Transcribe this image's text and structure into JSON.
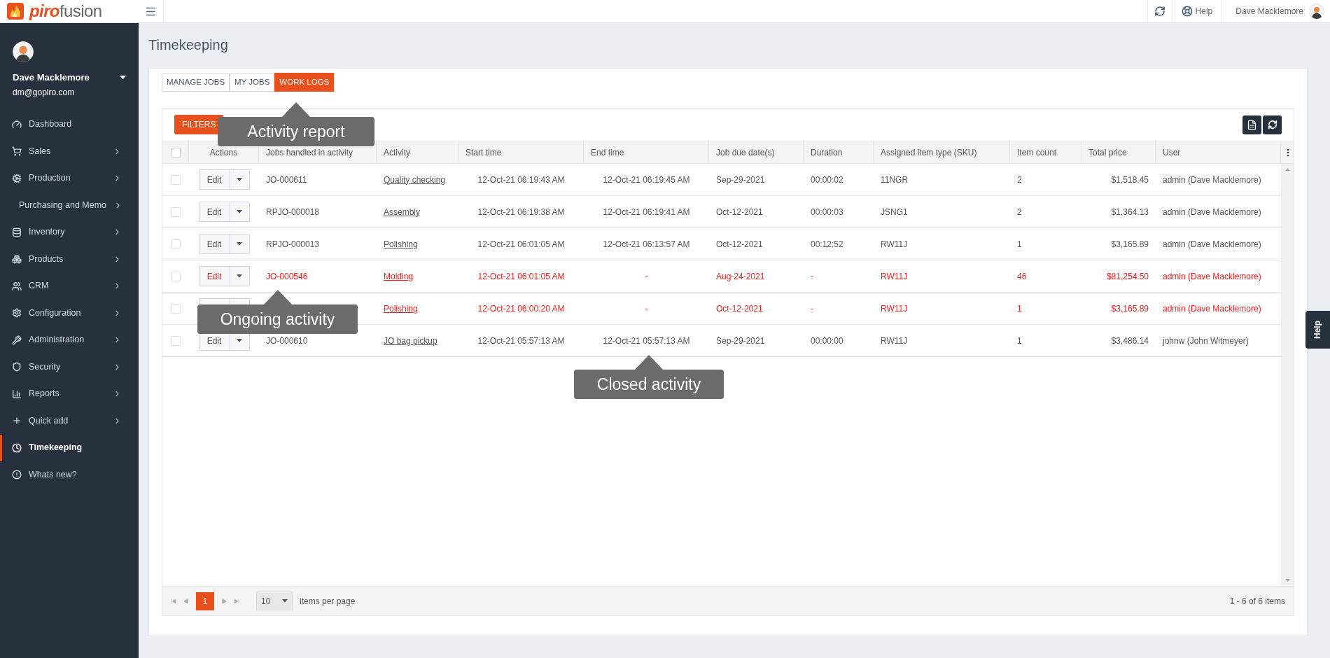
{
  "header": {
    "logo": "**piro**fusion",
    "help": "Help",
    "user": "Dave Macklemore"
  },
  "sidebar": {
    "user_name": "Dave Macklemore",
    "user_email": "dm@gopiro.com",
    "items": [
      {
        "label": "Dashboard",
        "selected": false,
        "chevron": false
      },
      {
        "label": "Sales",
        "selected": false,
        "chevron": true
      },
      {
        "label": "Production",
        "selected": false,
        "chevron": true
      },
      {
        "label": "Purchasing and Memo",
        "selected": false,
        "chevron": true
      },
      {
        "label": "Inventory",
        "selected": false,
        "chevron": true
      },
      {
        "label": "Products",
        "selected": false,
        "chevron": true
      },
      {
        "label": "CRM",
        "selected": false,
        "chevron": true
      },
      {
        "label": "Configuration",
        "selected": false,
        "chevron": true
      },
      {
        "label": "Administration",
        "selected": false,
        "chevron": true
      },
      {
        "label": "Security",
        "selected": false,
        "chevron": true
      },
      {
        "label": "Reports",
        "selected": false,
        "chevron": true
      },
      {
        "label": "Quick add",
        "selected": false,
        "chevron": true
      },
      {
        "label": "Timekeeping",
        "selected": true,
        "chevron": false
      },
      {
        "label": "Whats new?",
        "selected": false,
        "chevron": false
      }
    ]
  },
  "page_title": "Timekeeping",
  "tabs": [
    {
      "label": "MANAGE JOBS",
      "selected": false
    },
    {
      "label": "MY JOBS",
      "selected": false
    },
    {
      "label": "WORK LOGS",
      "selected": true
    }
  ],
  "filters_button": "FILTERS",
  "table": {
    "select_all": {
      "checked": false
    },
    "columns": [
      "Actions",
      "Jobs handled in activity",
      "Activity",
      "Start time",
      "End time",
      "Job due date(s)",
      "Duration",
      "Assigned item type (SKU)",
      "Item count",
      "Total price",
      "User"
    ],
    "rows": [
      {
        "ongoing": false,
        "edit": "Edit",
        "job": "JO-000611",
        "activity": "Quality checking",
        "start": "12-Oct-21 06:19:43 AM",
        "end": "12-Oct-21 06:19:45 AM",
        "due": "Sep-29-2021",
        "duration": "00:00:02",
        "sku": "11NGR",
        "count": "2",
        "price": "$1,518.45",
        "user": "admin (Dave Macklemore)"
      },
      {
        "ongoing": false,
        "edit": "Edit",
        "job": "RPJO-000018",
        "activity": "Assembly",
        "start": "12-Oct-21 06:19:38 AM",
        "end": "12-Oct-21 06:19:41 AM",
        "due": "Oct-12-2021",
        "duration": "00:00:03",
        "sku": "JSNG1",
        "count": "2",
        "price": "$1,364.13",
        "user": "admin (Dave Macklemore)"
      },
      {
        "ongoing": false,
        "edit": "Edit",
        "job": "RPJO-000013",
        "activity": "Polishing",
        "start": "12-Oct-21 06:01:05 AM",
        "end": "12-Oct-21 06:13:57 AM",
        "due": "Oct-12-2021",
        "duration": "00:12:52",
        "sku": "RW11J",
        "count": "1",
        "price": "$3,165.89",
        "user": "admin (Dave Macklemore)"
      },
      {
        "ongoing": true,
        "edit": "Edit",
        "job": "JO-000546",
        "activity": "Molding",
        "start": "12-Oct-21 06:01:05 AM",
        "end": "-",
        "due": "Aug-24-2021",
        "duration": "-",
        "sku": "RW11J",
        "count": "46",
        "price": "$81,254.50",
        "user": "admin (Dave Macklemore)"
      },
      {
        "ongoing": true,
        "activity": "Polishing",
        "start": "12-Oct-21 06:00:20 AM",
        "end": "-",
        "due": "Oct-12-2021",
        "duration": "-",
        "sku": "RW11J",
        "count": "1",
        "price": "$3,165.89",
        "user": "admin (Dave Macklemore)"
      },
      {
        "ongoing": false,
        "edit": "Edit",
        "job": "JO-000610",
        "activity": "JO bag pickup",
        "start": "12-Oct-21 05:57:13 AM",
        "end": "12-Oct-21 05:57:13 AM",
        "due": "Sep-29-2021",
        "duration": "00:00:00",
        "sku": "RW11J",
        "count": "1",
        "price": "$3,486.14",
        "user": "johnw (John Witmeyer)"
      }
    ]
  },
  "pager": {
    "pages": [
      {
        "label": "1",
        "selected": true
      }
    ],
    "page_size": "10",
    "per_page_label": "items per page",
    "summary": "1 - 6 of 6 items"
  },
  "callouts": [
    "Activity report",
    "Ongoing activity",
    "Closed activity"
  ],
  "help_tab": "Help"
}
